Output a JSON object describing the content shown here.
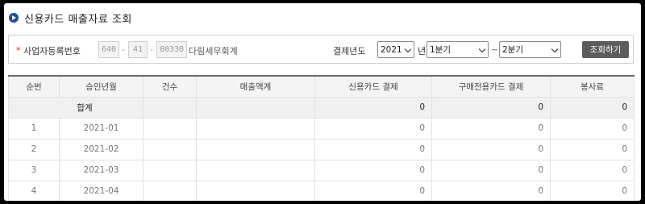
{
  "page": {
    "title": "신용카드 매출자료 조회"
  },
  "search": {
    "required_mark": "*",
    "biz_label": "사업자등록번호",
    "biz_part1": "640",
    "biz_part2": "41",
    "biz_part3": "00330",
    "dash": "-",
    "company_name": "다림세무회계",
    "year_label": "결제년도",
    "year_value": "2021",
    "year_suffix": "년",
    "from_quarter": "1분기",
    "tilde": "~",
    "to_quarter": "2분기",
    "search_button": "조회하기"
  },
  "table": {
    "headers": [
      "순번",
      "승인년월",
      "건수",
      "매출액계",
      "신용카드 결제",
      "구매전용카드 결제",
      "봉사료"
    ],
    "summary": {
      "label": "합계",
      "credit": "0",
      "purchase": "0",
      "service": "0"
    },
    "rows": [
      {
        "no": "1",
        "ym": "2021-01",
        "count": "",
        "total": "",
        "credit": "0",
        "purchase": "0",
        "service": "0"
      },
      {
        "no": "2",
        "ym": "2021-02",
        "count": "",
        "total": "",
        "credit": "0",
        "purchase": "0",
        "service": "0"
      },
      {
        "no": "3",
        "ym": "2021-03",
        "count": "",
        "total": "",
        "credit": "0",
        "purchase": "0",
        "service": "0"
      },
      {
        "no": "4",
        "ym": "2021-04",
        "count": "",
        "total": "",
        "credit": "0",
        "purchase": "0",
        "service": "0"
      }
    ]
  }
}
